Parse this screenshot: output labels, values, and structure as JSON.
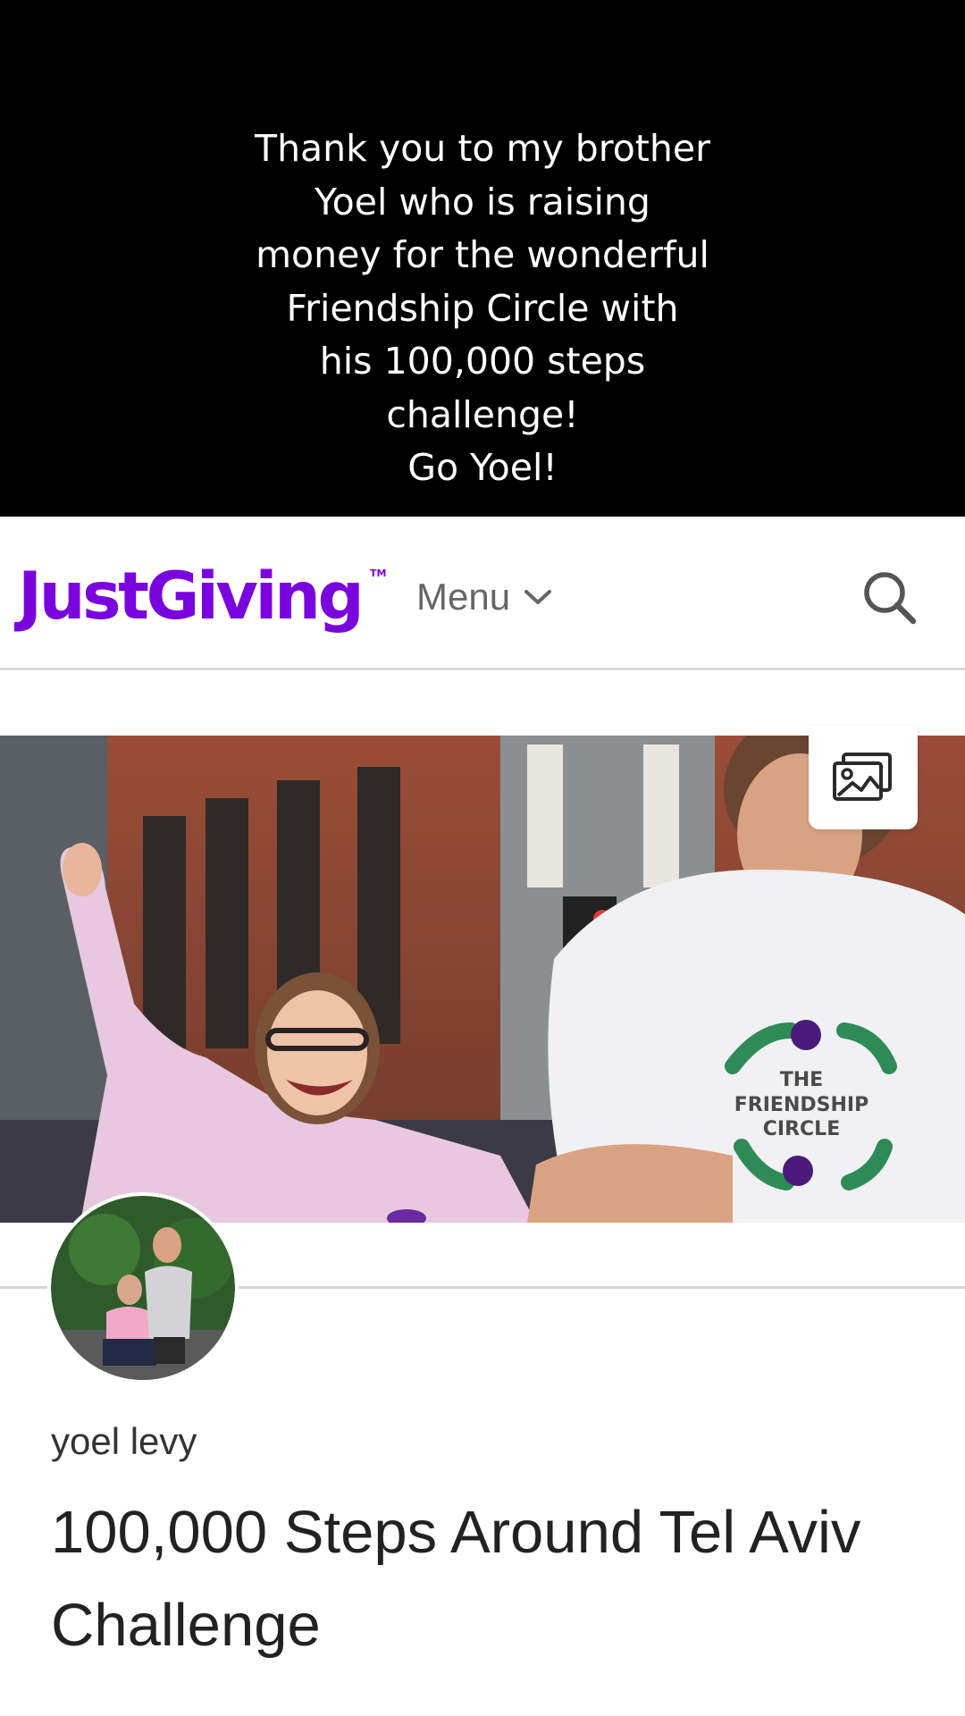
{
  "overlay": {
    "caption_lines": [
      "Thank you to my brother",
      "Yoel who is raising",
      "money for the wonderful",
      "Friendship Circle with",
      "his 100,000 steps",
      "challenge!",
      "Go Yoel!"
    ]
  },
  "header": {
    "logo_text": "JustGiving",
    "logo_tm": "TM",
    "menu_label": "Menu",
    "menu_icon": "chevron-down-icon",
    "search_icon": "search-icon"
  },
  "hero": {
    "gallery_icon": "image-gallery-icon",
    "shirt_logo": [
      "THE",
      "FRIENDSHIP",
      "CIRCLE"
    ]
  },
  "profile": {
    "owner_name": "yoel levy",
    "page_title": "100,000 Steps Around Tel Aviv Challenge"
  },
  "colors": {
    "brand": "#7a04dd",
    "overlay_bg": "#000000",
    "caption_text": "#ffffff",
    "menu_text": "#666666",
    "title_text": "#222222",
    "divider": "#d4d4d4",
    "friendship_green": "#2e8b57",
    "friendship_purple": "#4b1a7a"
  }
}
